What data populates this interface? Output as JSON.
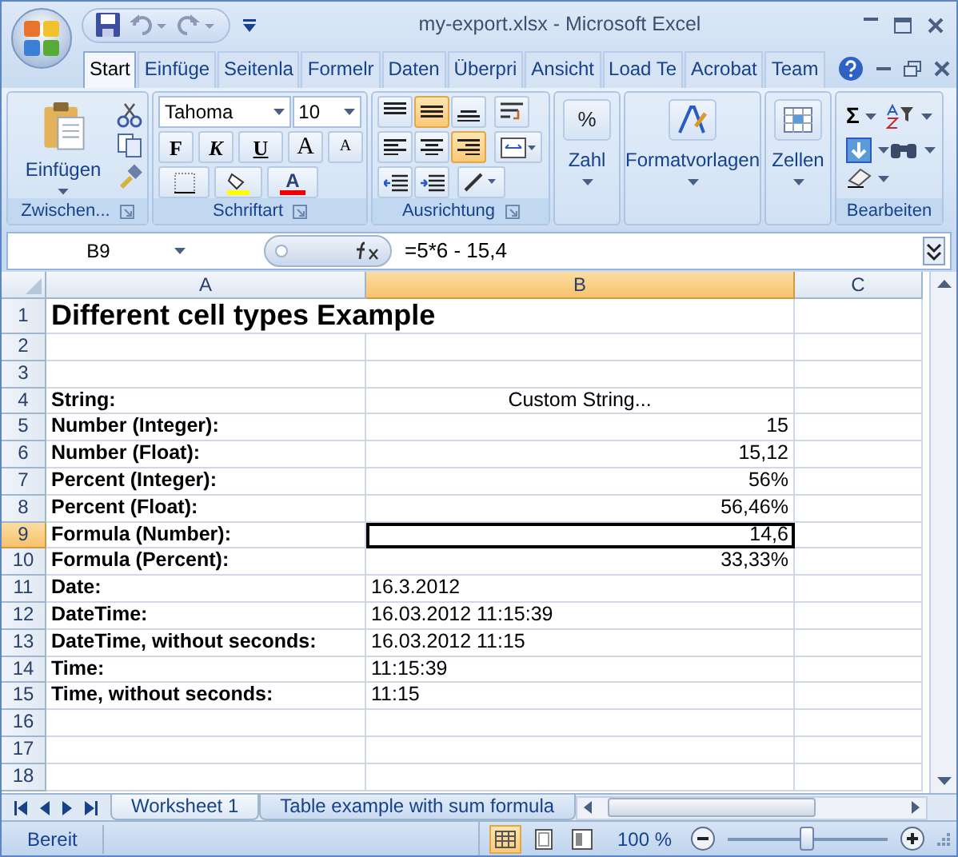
{
  "window": {
    "title": "my-export.xlsx - Microsoft Excel"
  },
  "ribbon_tabs": [
    {
      "label": "Start",
      "selected": true
    },
    {
      "label": "Einfüge",
      "selected": false
    },
    {
      "label": "Seitenla",
      "selected": false
    },
    {
      "label": "Formelr",
      "selected": false
    },
    {
      "label": "Daten",
      "selected": false
    },
    {
      "label": "Überpri",
      "selected": false
    },
    {
      "label": "Ansicht",
      "selected": false
    },
    {
      "label": "Load Te",
      "selected": false
    },
    {
      "label": "Acrobat",
      "selected": false
    },
    {
      "label": "Team",
      "selected": false
    }
  ],
  "ribbon": {
    "clipboard": {
      "label": "Zwischen...",
      "paste": "Einfügen"
    },
    "font": {
      "label": "Schriftart",
      "font_name": "Tahoma",
      "font_size": "10",
      "bold": "F",
      "italic": "K",
      "underline": "U",
      "grow": "A",
      "shrink": "A",
      "font_color": "A"
    },
    "alignment": {
      "label": "Ausrichtung",
      "vertical": [
        {
          "kind": "top",
          "selected": false
        },
        {
          "kind": "middle",
          "selected": true
        },
        {
          "kind": "bottom",
          "selected": false
        }
      ],
      "horizontal": [
        {
          "kind": "left",
          "selected": false
        },
        {
          "kind": "center",
          "selected": false
        },
        {
          "kind": "right",
          "selected": true
        }
      ]
    },
    "number": {
      "label": "Zahl",
      "glyph": "%"
    },
    "styles": {
      "label": "Formatvorlagen"
    },
    "cells": {
      "label": "Zellen"
    },
    "editing": {
      "label": "Bearbeiten",
      "sum": "Σ"
    }
  },
  "formula_bar": {
    "name_box": "B9",
    "formula": "=5*6 - 15,4"
  },
  "columns": [
    {
      "label": "A",
      "selected": false
    },
    {
      "label": "B",
      "selected": true
    },
    {
      "label": "C",
      "selected": false
    }
  ],
  "rows": [
    {
      "number": "1",
      "kind": "title",
      "selected": false,
      "cells": [
        {
          "text": "Different cell types Example",
          "kind": "title",
          "selected": false
        }
      ]
    },
    {
      "number": "2",
      "kind": "plain",
      "selected": false,
      "cells": []
    },
    {
      "number": "3",
      "kind": "plain",
      "selected": false,
      "cells": []
    },
    {
      "number": "4",
      "kind": "plain",
      "selected": false,
      "cells": [
        {
          "text": "String:",
          "kind": "label",
          "selected": false
        },
        {
          "text": "Custom String...",
          "kind": "centered",
          "selected": false
        }
      ]
    },
    {
      "number": "5",
      "kind": "plain",
      "selected": false,
      "cells": [
        {
          "text": "Number (Integer):",
          "kind": "label",
          "selected": false
        },
        {
          "text": "15",
          "kind": "number",
          "selected": false
        }
      ]
    },
    {
      "number": "6",
      "kind": "plain",
      "selected": false,
      "cells": [
        {
          "text": "Number (Float):",
          "kind": "label",
          "selected": false
        },
        {
          "text": "15,12",
          "kind": "number",
          "selected": false
        }
      ]
    },
    {
      "number": "7",
      "kind": "plain",
      "selected": false,
      "cells": [
        {
          "text": "Percent (Integer):",
          "kind": "label",
          "selected": false
        },
        {
          "text": "56%",
          "kind": "number",
          "selected": false
        }
      ]
    },
    {
      "number": "8",
      "kind": "plain",
      "selected": false,
      "cells": [
        {
          "text": "Percent (Float):",
          "kind": "label",
          "selected": false
        },
        {
          "text": "56,46%",
          "kind": "number",
          "selected": false
        }
      ]
    },
    {
      "number": "9",
      "kind": "plain",
      "selected": true,
      "cells": [
        {
          "text": "Formula (Number):",
          "kind": "label",
          "selected": false
        },
        {
          "text": "14,6",
          "kind": "number",
          "selected": true
        }
      ]
    },
    {
      "number": "10",
      "kind": "plain",
      "selected": false,
      "cells": [
        {
          "text": "Formula (Percent):",
          "kind": "label",
          "selected": false
        },
        {
          "text": "33,33%",
          "kind": "number",
          "selected": false
        }
      ]
    },
    {
      "number": "11",
      "kind": "plain",
      "selected": false,
      "cells": [
        {
          "text": "Date:",
          "kind": "label",
          "selected": false
        },
        {
          "text": "16.3.2012",
          "kind": "date",
          "selected": false
        }
      ]
    },
    {
      "number": "12",
      "kind": "plain",
      "selected": false,
      "cells": [
        {
          "text": "DateTime:",
          "kind": "label",
          "selected": false
        },
        {
          "text": "16.03.2012 11:15:39",
          "kind": "date",
          "selected": false
        }
      ]
    },
    {
      "number": "13",
      "kind": "plain",
      "selected": false,
      "cells": [
        {
          "text": "DateTime, without seconds:",
          "kind": "label",
          "selected": false
        },
        {
          "text": "16.03.2012 11:15",
          "kind": "date",
          "selected": false
        }
      ]
    },
    {
      "number": "14",
      "kind": "plain",
      "selected": false,
      "cells": [
        {
          "text": "Time:",
          "kind": "label",
          "selected": false
        },
        {
          "text": "11:15:39",
          "kind": "date",
          "selected": false
        }
      ]
    },
    {
      "number": "15",
      "kind": "plain",
      "selected": false,
      "cells": [
        {
          "text": "Time, without seconds:",
          "kind": "label",
          "selected": false
        },
        {
          "text": "11:15",
          "kind": "date",
          "selected": false
        }
      ]
    },
    {
      "number": "16",
      "kind": "plain",
      "selected": false,
      "cells": []
    },
    {
      "number": "17",
      "kind": "plain",
      "selected": false,
      "cells": []
    },
    {
      "number": "18",
      "kind": "plain",
      "selected": false,
      "cells": []
    }
  ],
  "sheet_tabs": [
    {
      "label": "Worksheet 1",
      "selected": true
    },
    {
      "label": "Table example with sum formula",
      "selected": false
    }
  ],
  "status_bar": {
    "text": "Bereit",
    "view_buttons": [
      {
        "kind": "normal",
        "selected": true
      },
      {
        "kind": "layout",
        "selected": false
      },
      {
        "kind": "pagebreak",
        "selected": false
      }
    ],
    "zoom": "100 %",
    "zoom_slider": {
      "level": 0.5
    }
  }
}
